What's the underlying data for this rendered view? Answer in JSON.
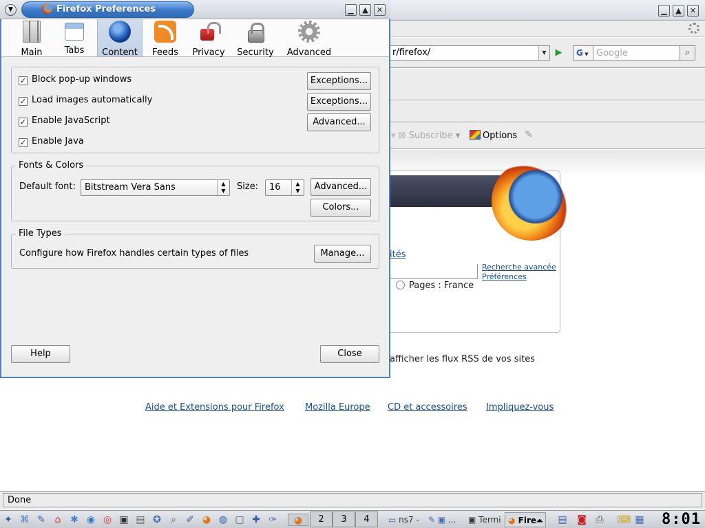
{
  "browser": {
    "url": "r/firefox/",
    "search_placeholder": "Google",
    "search_engine_label": "G",
    "subscribe_label": "Subscribe",
    "options_label": "Options",
    "partial_link": "ités",
    "advanced_search_link": "Recherche avancée",
    "preferences_link": "Préférences",
    "pages_radio_label": "Pages : France",
    "rss_text": "afficher les flux RSS de vos sites",
    "footer_links": [
      "Aide et Extensions pour Firefox",
      "Mozilla Europe",
      "CD et accessoires",
      "Impliquez-vous"
    ],
    "status": "Done"
  },
  "prefs": {
    "title": "Firefox Preferences",
    "tabs": [
      {
        "label": "Main",
        "icon": "main-icon"
      },
      {
        "label": "Tabs",
        "icon": "tabs-icon"
      },
      {
        "label": "Content",
        "icon": "globe-icon"
      },
      {
        "label": "Feeds",
        "icon": "rss-icon"
      },
      {
        "label": "Privacy",
        "icon": "privacy-lock-icon"
      },
      {
        "label": "Security",
        "icon": "padlock-icon"
      },
      {
        "label": "Advanced",
        "icon": "gear-icon"
      }
    ],
    "selected_tab": "Content",
    "checks": [
      {
        "label": "Block pop-up windows",
        "checked": true,
        "button": "Exceptions..."
      },
      {
        "label": "Load images automatically",
        "checked": true,
        "button": "Exceptions..."
      },
      {
        "label": "Enable JavaScript",
        "checked": true,
        "button": "Advanced..."
      },
      {
        "label": "Enable Java",
        "checked": true
      }
    ],
    "fonts": {
      "caption": "Fonts & Colors",
      "default_font_label": "Default font:",
      "default_font_value": "Bitstream Vera Sans",
      "size_label": "Size:",
      "size_value": "16",
      "advanced_button": "Advanced...",
      "colors_button": "Colors..."
    },
    "file_types": {
      "caption": "File Types",
      "description": "Configure how Firefox handles certain types of files",
      "manage_button": "Manage..."
    },
    "help_button": "Help",
    "close_button": "Close"
  },
  "taskbar": {
    "pager": [
      "2",
      "3",
      "4"
    ],
    "tasks": [
      "ns7 - ",
      "...",
      "Termi",
      "Fire"
    ],
    "clock": "8:01"
  },
  "colors": {
    "title_active": "#3b78c8",
    "dialog_border": "#4d83c4",
    "link": "#1a4fa0"
  }
}
